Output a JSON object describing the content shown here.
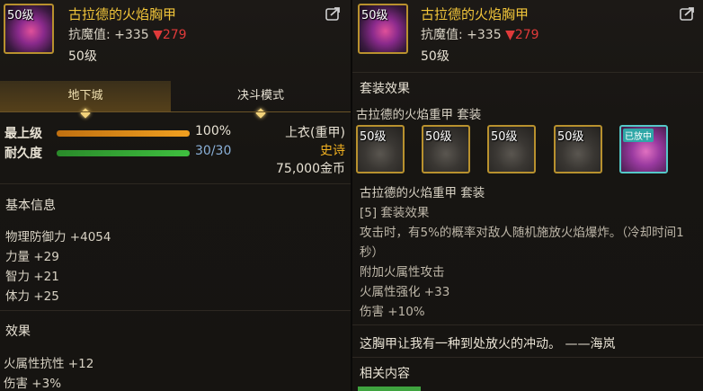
{
  "item": {
    "level_badge": "50级",
    "name": "古拉德的火焰胸甲",
    "stat_label": "抗魔值:",
    "stat_plus": "+335",
    "stat_down": "▼279",
    "level_text": "50级",
    "share_icon": "share-icon"
  },
  "tabs": [
    {
      "label": "地下城",
      "active": true
    },
    {
      "label": "决斗模式",
      "active": false
    }
  ],
  "bars": {
    "upgrade": {
      "label": "最上级",
      "value": "100%",
      "fraction": 1.0,
      "color": "#f0a020"
    },
    "durability": {
      "label": "耐久度",
      "value": "30/30",
      "fraction": 1.0,
      "color": "#3fbf3f"
    }
  },
  "slot_info": {
    "type": "上衣(重甲)",
    "rarity": "史诗",
    "price": "75,000金币",
    "rarity_color": "#f0b020"
  },
  "basic_info": {
    "heading": "基本信息",
    "lines": [
      "物理防御力 +4054",
      "力量 +29",
      "智力 +21",
      "体力 +25"
    ]
  },
  "effects": {
    "heading": "效果",
    "lines": [
      "火属性抗性 +12",
      "伤害 +3%"
    ]
  },
  "set": {
    "heading": "套装效果",
    "name_line": "古拉德的火焰重甲  套装",
    "slots": [
      {
        "level": "50级",
        "badge": ""
      },
      {
        "level": "50级",
        "badge": ""
      },
      {
        "level": "50级",
        "badge": ""
      },
      {
        "level": "50级",
        "badge": ""
      },
      {
        "level": "",
        "badge": "已放中"
      }
    ],
    "detail_name": "古拉德的火焰重甲  套装",
    "detail_count": "[5] 套装效果",
    "detail_lines": [
      "攻击时，有5%的概率对敌人随机施放火焰爆炸。（冷却时间1",
      "秒）",
      "附加火属性攻击",
      "火属性强化 +33",
      "伤害 +10%"
    ]
  },
  "flavor": "这胸甲让我有一种到处放火的冲动。  ——海岚",
  "related": {
    "heading": "相关内容"
  }
}
